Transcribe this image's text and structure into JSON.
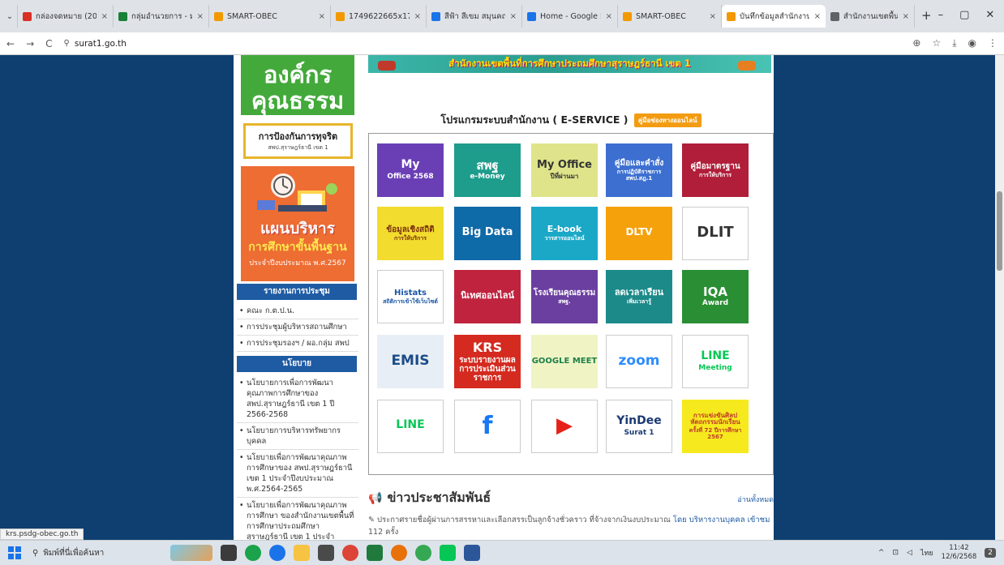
{
  "browser": {
    "tabs": [
      {
        "title": "กล่องจดหมาย (208) - ",
        "color": "#d93025"
      },
      {
        "title": "กลุ่มอำนวยการ - มูลกา",
        "color": "#188038"
      },
      {
        "title": "SMART-OBEC",
        "color": "#f29900"
      },
      {
        "title": "1749622665x176728",
        "color": "#f29900"
      },
      {
        "title": "สีฟ้า สีเขม สมุนคณ ก้",
        "color": "#1a73e8"
      },
      {
        "title": "Home - Google Drive",
        "color": "#1a73e8"
      },
      {
        "title": "SMART-OBEC",
        "color": "#f29900"
      },
      {
        "title": "บันทึกข้อมูลสำนักงาน",
        "color": "#f29900"
      },
      {
        "title": "สำนักงานเขตพื้นที่การศึ",
        "color": "#5f6368"
      }
    ],
    "active_tab": 7,
    "tab_close": "×",
    "new_tab": "+",
    "window_controls": [
      "–",
      "▢",
      "✕"
    ],
    "url": "surat1.go.th",
    "nav_icons": [
      "←",
      "→",
      "C"
    ],
    "right_icons": [
      "⊕",
      "☆",
      "⤓",
      "◉",
      "⋮"
    ]
  },
  "sidebar": {
    "promo_top": "องค์กร\nคุณธรรม",
    "anticorruption_title": "การป้องกันการทุจริต",
    "anticorruption_sub": "สพป.สุราษฎร์ธานี เขต 1",
    "plan_line1": "แผนบริหาร",
    "plan_line2": "การศึกษาขั้นพื้นฐาน",
    "plan_line3": "ประจำปีงบประมาณ พ.ศ.2567",
    "meetings_header": "รายงานการประชุม",
    "meetings": [
      "คณะ ก.ต.ป.น.",
      "การประชุมผู้บริหารสถานศึกษา",
      "การประชุมรองฯ / ผอ.กลุ่ม สพป"
    ],
    "policy_header": "นโยบาย",
    "policies": [
      "นโยบายการเพื่อการพัฒนาคุณภาพการศึกษาของ สพป.สุราษฎร์ธานี เขต 1 ปี 2566-2568",
      "นโยบายการบริหารทรัพยากรบุคคล",
      "นโยบายเพื่อการพัฒนาคุณภาพการศึกษาของ สพป.สุราษฎร์ธานี เขต 1 ประจำปีงบประมาณ พ.ศ.2564-2565",
      "นโยบายเพื่อการพัฒนาคุณภาพการศึกษา ของสำนักงานเขตพื้นที่การศึกษาประถมศึกษาสุราษฎร์ธานี เขต 1 ประจำ"
    ]
  },
  "main": {
    "banner": "สำนักงานเขตพื้นที่การศึกษาประถมศึกษาสุราษฎร์ธานี เขต 1",
    "eservice_title": "โปรแกรมระบบสำนักงาน ( E-SERVICE )",
    "eservice_badge": "คู่มือช่องทางออนไลน์",
    "tiles": [
      {
        "name": "my-office-2568",
        "l1": "My",
        "l2": "Office 2568",
        "bg": "#6a3fb5",
        "fg": "#ffffff",
        "size": 14
      },
      {
        "name": "e-money",
        "l1": "สพฐ",
        "l2": "e-Money",
        "bg": "#1e9c8c",
        "fg": "#ffffff",
        "size": 15
      },
      {
        "name": "my-office-past",
        "l1": "My Office",
        "l2": "ปีที่ผ่านมา",
        "bg": "#dfe48a",
        "fg": "#333333",
        "size": 13
      },
      {
        "name": "manual-orders",
        "l1": "คู่มือและคำสั่ง",
        "l2": "การปฏิบัติราชการ สพป.สฎ.1",
        "bg": "#3c6fd0",
        "fg": "#ffffff",
        "size": 10
      },
      {
        "name": "service-standard",
        "l1": "คู่มือมาตรฐาน",
        "l2": "การให้บริการ",
        "bg": "#b01e39",
        "fg": "#ffffff",
        "size": 10
      },
      {
        "name": "service-statistics",
        "l1": "ข้อมูลเชิงสถิติ",
        "l2": "การให้บริการ",
        "bg": "#f2dc2e",
        "fg": "#7a2f0f",
        "size": 10
      },
      {
        "name": "big-data",
        "l1": "Big Data",
        "l2": "",
        "bg": "#0f6aa8",
        "fg": "#ffffff",
        "size": 13
      },
      {
        "name": "e-book",
        "l1": "E-book",
        "l2": "วารสารออนไลน์",
        "bg": "#1ba8c7",
        "fg": "#ffffff",
        "size": 11
      },
      {
        "name": "dltv",
        "l1": "DLTV",
        "l2": "",
        "bg": "#f5a10b",
        "fg": "#ffffff",
        "size": 12
      },
      {
        "name": "dlit",
        "l1": "DLIT",
        "l2": "",
        "bg": "#ffffff",
        "fg": "#333333",
        "size": 18
      },
      {
        "name": "histats",
        "l1": "Histats",
        "l2": "สถิติการเข้าใช้เว็บไซต์",
        "bg": "#ffffff",
        "fg": "#1a56a6",
        "size": 10
      },
      {
        "name": "online-supervision",
        "l1": "นิเทศออนไลน์",
        "l2": "",
        "bg": "#c0233e",
        "fg": "#ffffff",
        "size": 11
      },
      {
        "name": "moral-school",
        "l1": "โรงเรียนคุณธรรม",
        "l2": "สพฐ.",
        "bg": "#6b3fa0",
        "fg": "#ffffff",
        "size": 10
      },
      {
        "name": "reduce-study-time",
        "l1": "ลดเวลาเรียน",
        "l2": "เพิ่มเวลารู้",
        "bg": "#1d8a8a",
        "fg": "#ffffff",
        "size": 11
      },
      {
        "name": "iqa-award",
        "l1": "IQA",
        "l2": "Award",
        "bg": "#2a8f34",
        "fg": "#ffffff",
        "size": 15
      },
      {
        "name": "emis",
        "l1": "EMIS",
        "l2": "",
        "bg": "#e8eef5",
        "fg": "#1c4c88",
        "size": 17
      },
      {
        "name": "krs",
        "l1": "KRS",
        "l2": "ระบบรายงานผลการประเมินส่วนราชการ",
        "bg": "#d42a1f",
        "fg": "#ffffff",
        "size": 16
      },
      {
        "name": "google-meet",
        "l1": "GOOGLE MEET",
        "l2": "",
        "bg": "#f0f4c4",
        "fg": "#1d7f4a",
        "size": 10
      },
      {
        "name": "zoom",
        "l1": "zoom",
        "l2": "",
        "bg": "#ffffff",
        "fg": "#2d8cff",
        "size": 17
      },
      {
        "name": "line-meeting",
        "l1": "LINE",
        "l2": "Meeting",
        "bg": "#ffffff",
        "fg": "#06c755",
        "size": 14
      },
      {
        "name": "line",
        "l1": "LINE",
        "l2": "",
        "bg": "#ffffff",
        "fg": "#06c755",
        "size": 14
      },
      {
        "name": "facebook",
        "l1": "f",
        "l2": "",
        "bg": "#ffffff",
        "fg": "#1877f2",
        "size": 30
      },
      {
        "name": "youtube",
        "l1": "▶",
        "l2": "",
        "bg": "#ffffff",
        "fg": "#e62117",
        "size": 26
      },
      {
        "name": "yindee",
        "l1": "YinDee",
        "l2": "Surat 1",
        "bg": "#ffffff",
        "fg": "#1b3a73",
        "size": 14
      },
      {
        "name": "art-competition",
        "l1": "การแข่งขันศิลปหัตถกรรมนักเรียน",
        "l2": "ครั้งที่ 72 ปีการศึกษา 2567",
        "bg": "#f6ea1e",
        "fg": "#c0392b",
        "size": 8
      }
    ],
    "news_title": "ข่าวประชาสัมพันธ์",
    "news_more": "อ่านทั้งหมด",
    "news_items": [
      {
        "text": "ประกาศรายชื่อผู้ผ่านการสรรหาและเลือกสรรเป็นลูกจ้างชั่วคราว ที่จ้างจากเงินงบประมาณ",
        "by": "โดย บริหารงานบุคคล เข้าชม",
        "count": "112 ครั้ง"
      }
    ]
  },
  "statusbar": "krs.psdg-obec.go.th",
  "taskbar": {
    "search": "พิมพ์ที่นี่เพื่อค้นหา",
    "lang": "ไทย",
    "time": "11:42",
    "date": "12/6/2568",
    "notif": "2"
  }
}
